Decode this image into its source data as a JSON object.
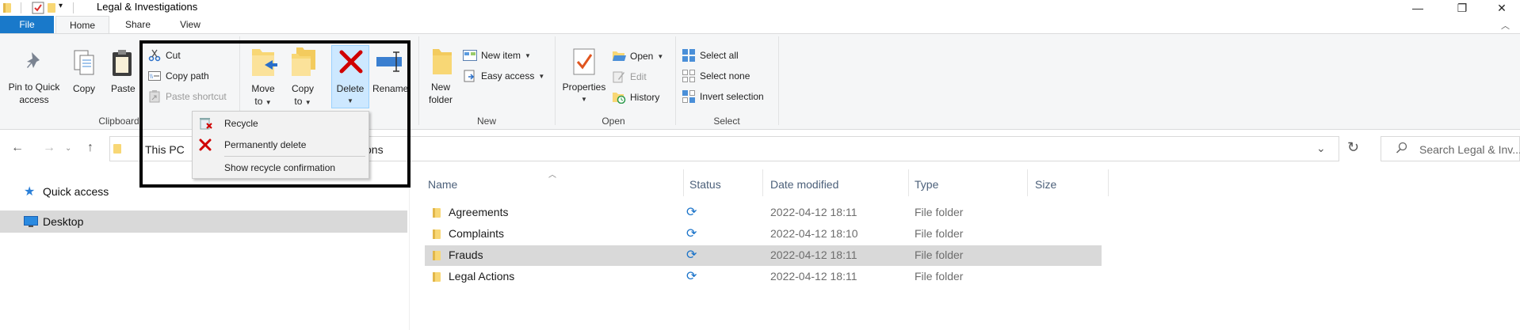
{
  "window": {
    "title": "Legal & Investigations",
    "min_glyph": "—",
    "max_glyph": "❐",
    "close_glyph": "✕"
  },
  "tabs": [
    "File",
    "Home",
    "Share",
    "View"
  ],
  "ribbon": {
    "pin_label_1": "Pin to Quick",
    "pin_label_2": "access",
    "copy_label": "Copy",
    "paste_label": "Paste",
    "cut_label": "Cut",
    "copy_path_label": "Copy path",
    "paste_shortcut_label": "Paste shortcut",
    "move_label_1": "Move",
    "move_label_2": "to",
    "copy_to_label_1": "Copy",
    "copy_to_label_2": "to",
    "delete_label": "Delete",
    "rename_label": "Rename",
    "new_folder_label_1": "New",
    "new_folder_label_2": "folder",
    "new_item_label": "New item",
    "easy_access_label": "Easy access",
    "properties_label": "Properties",
    "open_label": "Open",
    "edit_label": "Edit",
    "history_label": "History",
    "select_all_label": "Select all",
    "select_none_label": "Select none",
    "invert_selection_label": "Invert selection",
    "groups": {
      "clipboard": "Clipboard",
      "new": "New",
      "open": "Open",
      "select": "Select"
    }
  },
  "delete_menu": {
    "items": [
      "Recycle",
      "Permanently delete",
      "Show recycle confirmation"
    ]
  },
  "address": {
    "path_visible_start": "This PC",
    "path_visible_end": "ons",
    "search_placeholder": "Search Legal & Inv..."
  },
  "nav_pane": {
    "items": [
      "Quick access",
      "Desktop"
    ]
  },
  "file_list": {
    "columns": [
      "Name",
      "Status",
      "Date modified",
      "Type",
      "Size"
    ],
    "rows": [
      {
        "name": "Agreements",
        "date": "2022-04-12 18:11",
        "type": "File folder"
      },
      {
        "name": "Complaints",
        "date": "2022-04-12 18:10",
        "type": "File folder"
      },
      {
        "name": "Frauds",
        "date": "2022-04-12 18:11",
        "type": "File folder"
      },
      {
        "name": "Legal Actions",
        "date": "2022-04-12 18:11",
        "type": "File folder"
      }
    ]
  },
  "colors": {
    "accent": "#1979ca",
    "folder": "#f8d775",
    "delete_red": "#d00000",
    "sync_blue": "#1a73c9"
  }
}
